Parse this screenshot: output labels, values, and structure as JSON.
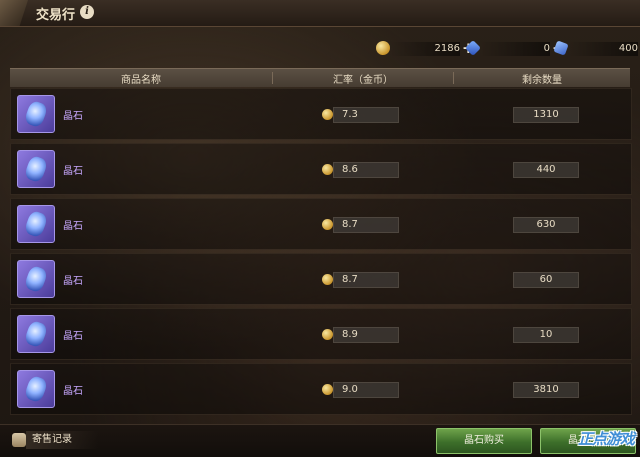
{
  "header": {
    "title": "交易行"
  },
  "currencies": [
    {
      "icon": "gold-coin-icon",
      "value": "2186"
    },
    {
      "icon": "blue-gem-icon",
      "value": "0"
    },
    {
      "icon": "blue-crystal-icon",
      "value": "400"
    }
  ],
  "table": {
    "headers": [
      "商品名称",
      "汇率（金币）",
      "剩余数量"
    ],
    "rows": [
      {
        "name": "晶石",
        "rate": "7.3",
        "qty": "1310"
      },
      {
        "name": "晶石",
        "rate": "8.6",
        "qty": "440"
      },
      {
        "name": "晶石",
        "rate": "8.7",
        "qty": "630"
      },
      {
        "name": "晶石",
        "rate": "8.7",
        "qty": "60"
      },
      {
        "name": "晶石",
        "rate": "8.9",
        "qty": "10"
      },
      {
        "name": "晶石",
        "rate": "9.0",
        "qty": "3810"
      }
    ]
  },
  "footer": {
    "record_label": "寄售记录",
    "buy_button": "晶石购买",
    "sell_button": "晶石寄售"
  },
  "watermark": "正点游戏",
  "colors": {
    "accent_green": "#4f8a33",
    "item_purple": "#6b58c8",
    "name_purple": "#c8a8ff"
  }
}
